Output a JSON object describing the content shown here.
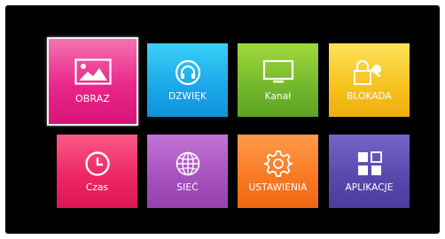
{
  "tiles": [
    {
      "id": "obraz",
      "label": "OBRAZ",
      "icon": "image-icon",
      "color": "#e9268a",
      "selected": true
    },
    {
      "id": "dzwiek",
      "label": "DZWIĘK",
      "icon": "headphones-icon",
      "color": "#1aa7e8",
      "selected": false
    },
    {
      "id": "kanal",
      "label": "Kanał",
      "icon": "tv-icon",
      "color": "#73b72c",
      "selected": false
    },
    {
      "id": "blokada",
      "label": "BLOKADA",
      "icon": "lock-key-icon",
      "color": "#f6c21d",
      "selected": false
    },
    {
      "id": "czas",
      "label": "Czas",
      "icon": "clock-icon",
      "color": "#ec2464",
      "selected": false
    },
    {
      "id": "siec",
      "label": "SIEĆ",
      "icon": "globe-icon",
      "color": "#a64fbe",
      "selected": false
    },
    {
      "id": "ustawienia",
      "label": "USTAWIENIA",
      "icon": "gear-icon",
      "color": "#f97922",
      "selected": false
    },
    {
      "id": "aplikacje",
      "label": "APLIKACJE",
      "icon": "apps-grid-icon",
      "color": "#5647ad",
      "selected": false
    }
  ]
}
